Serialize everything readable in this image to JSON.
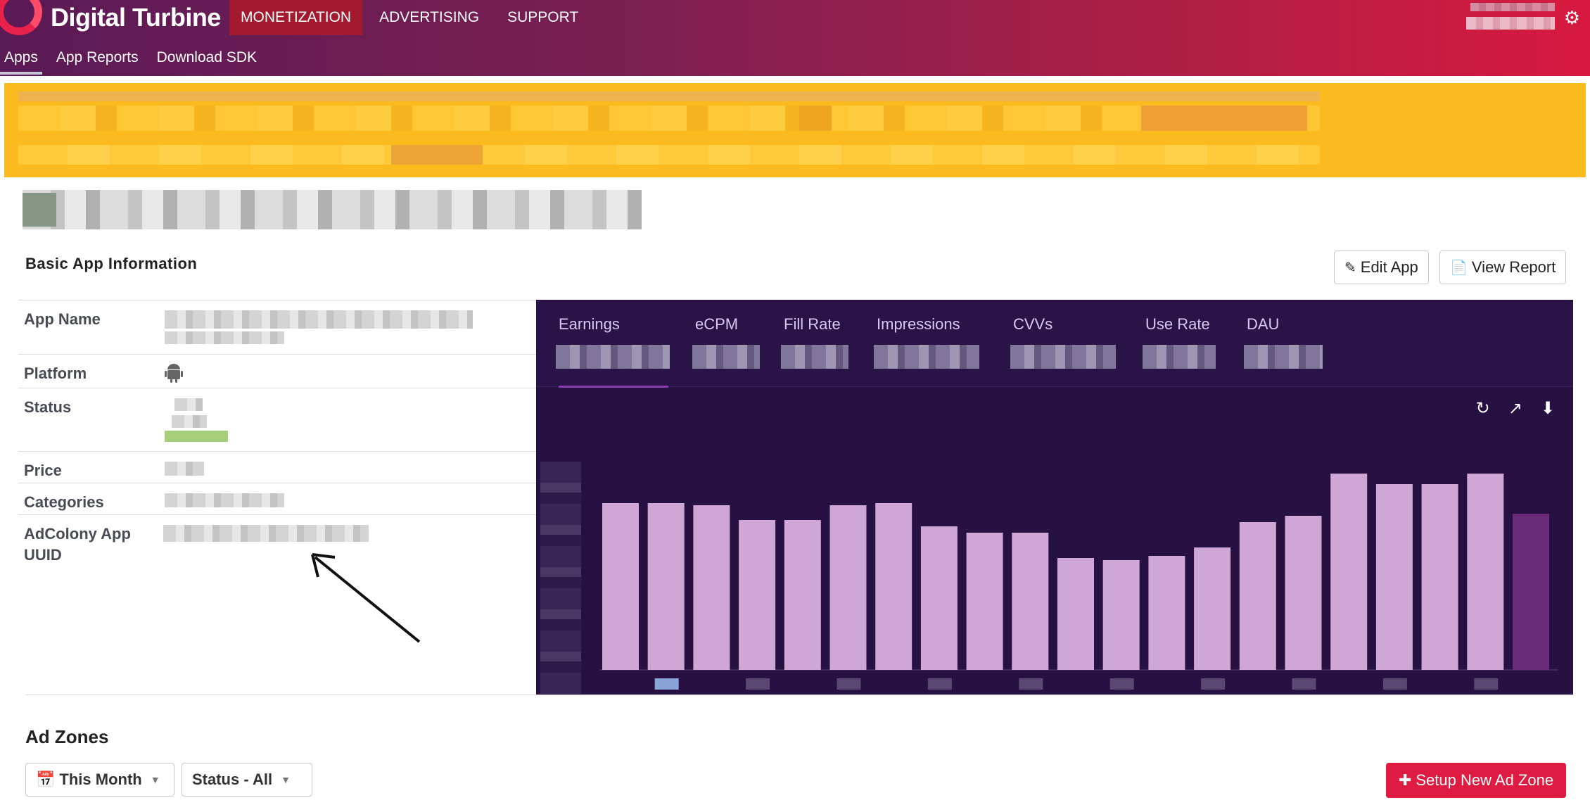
{
  "brand": {
    "name": "Digital Turbine",
    "accent": "#de1b40",
    "header_gradient": [
      "#5a1a55",
      "#d8193f"
    ]
  },
  "main_nav": [
    {
      "label": "MONETIZATION",
      "active": true
    },
    {
      "label": "ADVERTISING",
      "active": false
    },
    {
      "label": "SUPPORT",
      "active": false
    }
  ],
  "sub_nav": [
    {
      "label": "Apps",
      "active": true
    },
    {
      "label": "App Reports",
      "active": false
    },
    {
      "label": "Download SDK",
      "active": false
    }
  ],
  "header_icons": {
    "settings": "gear-icon"
  },
  "basic_info": {
    "title": "Basic App Information",
    "edit_button": "Edit App",
    "view_report_button": "View Report",
    "rows": {
      "app_name": "App Name",
      "platform": "Platform",
      "status": "Status",
      "price": "Price",
      "categories": "Categories",
      "uuid": "AdColony App UUID"
    },
    "platform_icon": "android-icon"
  },
  "stats": {
    "tabs": [
      "Earnings",
      "eCPM",
      "Fill Rate",
      "Impressions",
      "CVVs",
      "Use Rate",
      "DAU"
    ],
    "active_tab": "Earnings",
    "tools": [
      "refresh-icon",
      "line-chart-icon",
      "download-icon"
    ]
  },
  "chart_data": {
    "type": "bar",
    "title": "",
    "xlabel": "",
    "ylabel": "",
    "values": [
      0.79,
      0.79,
      0.78,
      0.71,
      0.71,
      0.78,
      0.79,
      0.68,
      0.65,
      0.65,
      0.53,
      0.52,
      0.54,
      0.58,
      0.7,
      0.73,
      0.93,
      0.88,
      0.88,
      0.93,
      0.74
    ],
    "highlight_last": true,
    "bar_color": "#cfa7d6",
    "highlight_color": "#6a2b7a"
  },
  "ad_zones": {
    "title": "Ad Zones",
    "period_select": "This Month",
    "status_select": "Status - All",
    "setup_button": "Setup New Ad Zone"
  }
}
